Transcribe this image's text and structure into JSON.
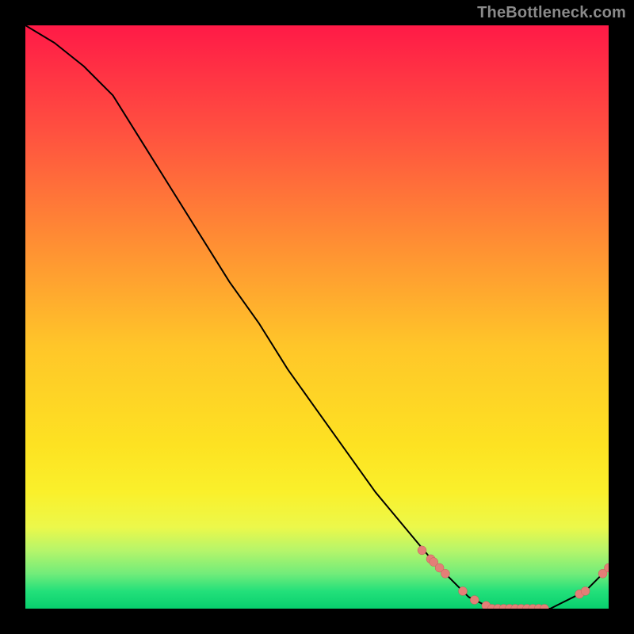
{
  "watermark": "TheBottleneck.com",
  "chart_data": {
    "type": "line",
    "title": "",
    "xlabel": "",
    "ylabel": "",
    "xlim": [
      0,
      100
    ],
    "ylim": [
      0,
      100
    ],
    "grid": false,
    "legend": false,
    "series": [
      {
        "name": "curve",
        "x": [
          0,
          5,
          10,
          15,
          20,
          25,
          30,
          35,
          40,
          45,
          50,
          55,
          60,
          65,
          70,
          72,
          74,
          76,
          78,
          80,
          82,
          84,
          86,
          88,
          90,
          92,
          94,
          96,
          98,
          100
        ],
        "y": [
          100,
          97,
          93,
          88,
          80,
          72,
          64,
          56,
          49,
          41,
          34,
          27,
          20,
          14,
          8,
          6,
          4,
          2,
          1,
          0,
          0,
          0,
          0,
          0,
          0,
          1,
          2,
          3,
          5,
          7
        ]
      }
    ],
    "points": [
      {
        "x": 68,
        "y": 10
      },
      {
        "x": 69.5,
        "y": 8.5
      },
      {
        "x": 70,
        "y": 8
      },
      {
        "x": 71,
        "y": 7
      },
      {
        "x": 72,
        "y": 6
      },
      {
        "x": 75,
        "y": 3
      },
      {
        "x": 77,
        "y": 1.5
      },
      {
        "x": 79,
        "y": 0.5
      },
      {
        "x": 80,
        "y": 0
      },
      {
        "x": 81,
        "y": 0
      },
      {
        "x": 82,
        "y": 0
      },
      {
        "x": 83,
        "y": 0
      },
      {
        "x": 84,
        "y": 0
      },
      {
        "x": 85,
        "y": 0
      },
      {
        "x": 86,
        "y": 0
      },
      {
        "x": 87,
        "y": 0
      },
      {
        "x": 88,
        "y": 0
      },
      {
        "x": 89,
        "y": 0
      },
      {
        "x": 95,
        "y": 2.5
      },
      {
        "x": 96,
        "y": 3
      },
      {
        "x": 99,
        "y": 6
      },
      {
        "x": 100,
        "y": 7
      }
    ],
    "colors": {
      "line": "#000000",
      "point_fill": "#e37f77",
      "point_stroke": "#c25f57"
    }
  }
}
